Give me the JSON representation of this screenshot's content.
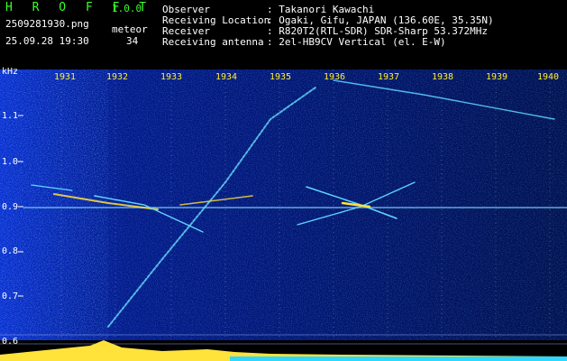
{
  "header": {
    "app_title": "H R O F F T",
    "app_version": "1.0.0",
    "file_name": "2509281930.png",
    "meteor_label": "meteor",
    "date_time": "25.09.28 19:30",
    "meteor_count": "34"
  },
  "info": {
    "observer_key": "Observer",
    "observer_val": ": Takanori Kawachi",
    "location_key": "Receiving Location",
    "location_val": ": Ogaki, Gifu, JAPAN (136.60E, 35.35N)",
    "receiver_key": "Receiver",
    "receiver_val": ": R820T2(RTL-SDR) SDR-Sharp 53.372MHz",
    "antenna_key": "Receiving antenna",
    "antenna_val": ": 2el-HB9CV Vertical (el. E-W)"
  },
  "axes": {
    "y_unit": "kHz",
    "y_ticks": [
      "1.1",
      "1.0",
      "0.9",
      "0.8",
      "0.7",
      "0.6"
    ],
    "x_ticks": [
      "1931",
      "1932",
      "1933",
      "1934",
      "1935",
      "1936",
      "1937",
      "1938",
      "1939",
      "1940"
    ]
  },
  "colors": {
    "background_dark": "#000030",
    "noise_blue": "#0a2fd0",
    "trail_cyan": "#5fd6ff",
    "trail_yellow": "#ffe23a",
    "tick_yellow": "#ffee33",
    "header_green": "#39ff2a",
    "bottom_cyan": "#2fd8ff"
  }
}
